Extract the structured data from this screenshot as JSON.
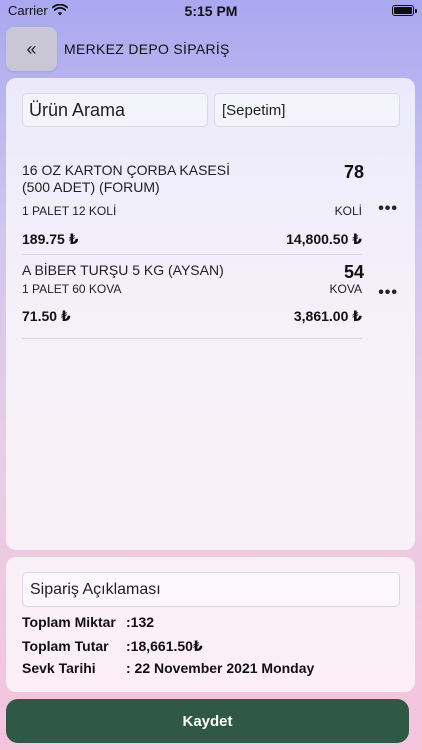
{
  "status_bar": {
    "carrier": "Carrier",
    "time": "5:15 PM"
  },
  "header": {
    "back_label": "«",
    "title": "MERKEZ DEPO SİPARİŞ"
  },
  "search": {
    "label": "Ürün Arama"
  },
  "cart": {
    "label": "[Sepetim]"
  },
  "items": [
    {
      "name": "16 OZ KARTON ÇORBA KASESİ (500 ADET) (FORUM)",
      "quantity": "78",
      "package": "1 PALET 12 KOLİ",
      "unit": "KOLİ",
      "unit_price": "189.75 ₺",
      "line_total": "14,800.50 ₺",
      "more": "•••"
    },
    {
      "name": "A BİBER TURŞU 5 KG (AYSAN)",
      "quantity": "54",
      "package": "1 PALET 60 KOVA",
      "unit": "KOVA",
      "unit_price": "71.50 ₺",
      "line_total": "3,861.00 ₺",
      "more": "•••"
    }
  ],
  "summary": {
    "note_label": "Sipariş Açıklaması",
    "total_qty_label": "Toplam Miktar",
    "total_qty_value": ":132",
    "total_amount_label": "Toplam Tutar",
    "total_amount_value": ":18,661.50₺",
    "ship_date_label": "Sevk Tarihi",
    "ship_date_value": ": 22 November 2021 Monday"
  },
  "footer": {
    "save_label": "Kaydet"
  },
  "colors": {
    "save_button": "#2f5846",
    "back_button": "#c9c7d6"
  },
  "icons": {
    "wifi": "wifi-icon",
    "battery": "battery-icon",
    "more": "more-icon"
  }
}
